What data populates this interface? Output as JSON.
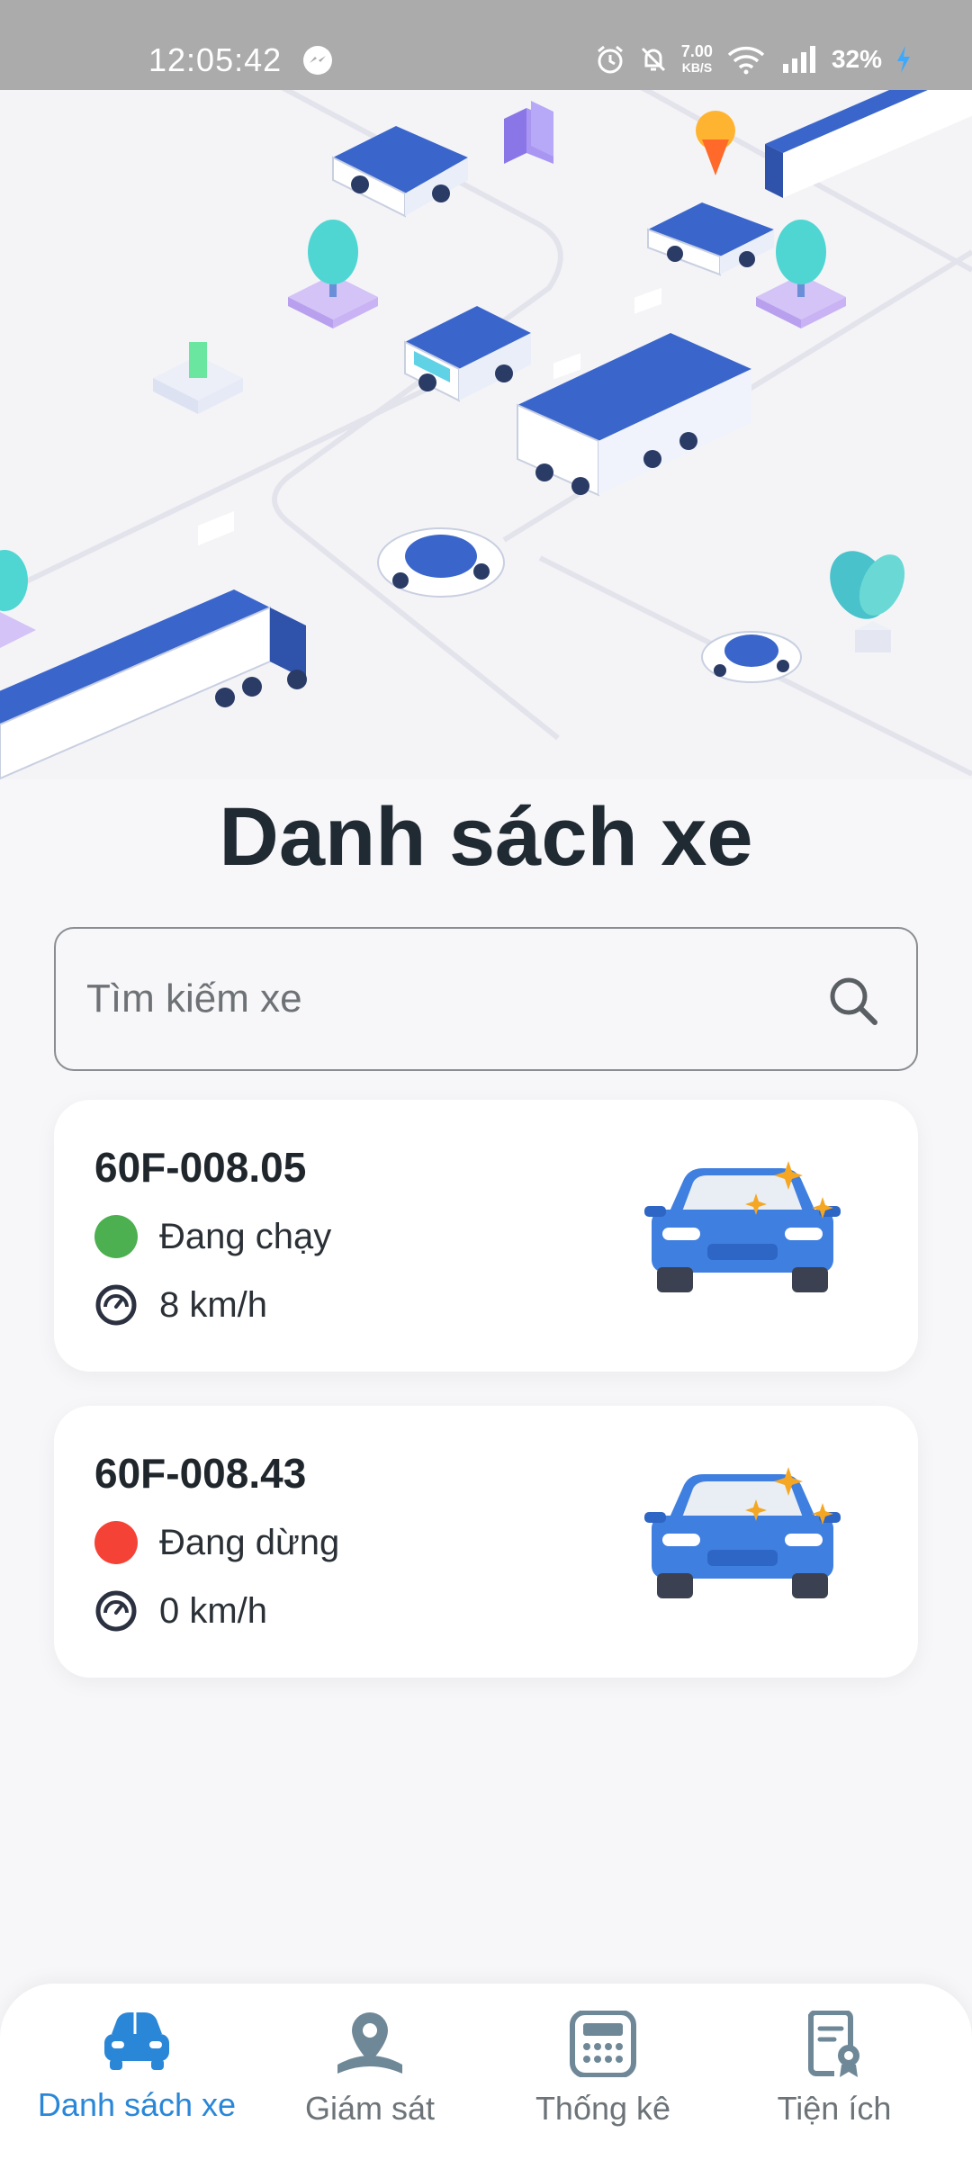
{
  "status_bar": {
    "time": "12:05:42",
    "net_speed": "7.00",
    "net_unit": "KB/S",
    "battery": "32%"
  },
  "page": {
    "title": "Danh sách xe"
  },
  "search": {
    "placeholder": "Tìm kiếm xe"
  },
  "vehicles": [
    {
      "plate": "60F-008.05",
      "status": "Đang chạy",
      "status_color": "#4caf50",
      "speed": "8 km/h"
    },
    {
      "plate": "60F-008.43",
      "status": "Đang dừng",
      "status_color": "#f44336",
      "speed": "0 km/h"
    }
  ],
  "nav": {
    "items": [
      {
        "label": "Danh sách xe",
        "icon": "car-icon",
        "active": true
      },
      {
        "label": "Giám sát",
        "icon": "map-pin-icon",
        "active": false
      },
      {
        "label": "Thống kê",
        "icon": "calculator-icon",
        "active": false
      },
      {
        "label": "Tiện ích",
        "icon": "certificate-icon",
        "active": false
      }
    ]
  },
  "colors": {
    "accent": "#2a87d8",
    "title": "#202a33",
    "car_blue": "#3f7fe0",
    "icon_gray": "#6f8897"
  }
}
